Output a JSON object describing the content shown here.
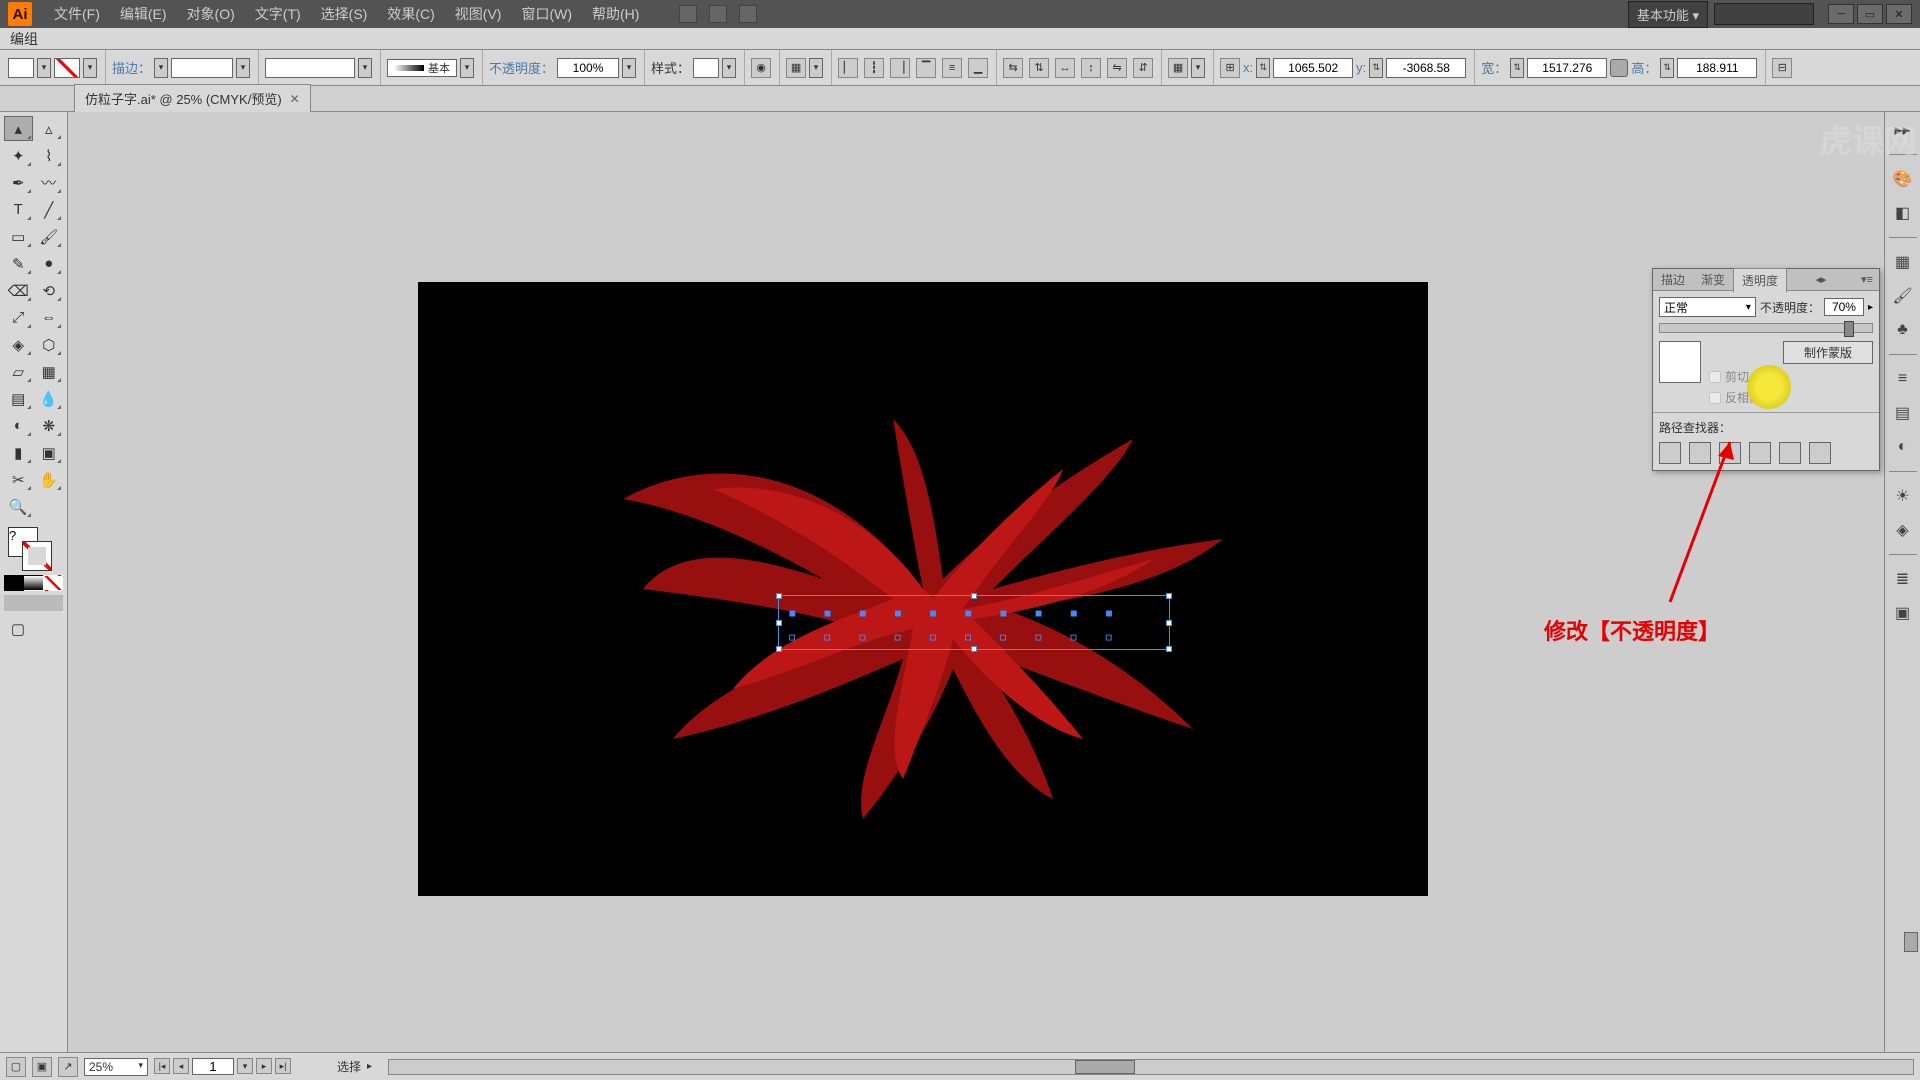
{
  "menubar": {
    "items": [
      "文件(F)",
      "编辑(E)",
      "对象(O)",
      "文字(T)",
      "选择(S)",
      "效果(C)",
      "视图(V)",
      "窗口(W)",
      "帮助(H)"
    ],
    "workspace": "基本功能"
  },
  "context": {
    "label": "编组"
  },
  "options": {
    "stroke_label": "描边：",
    "stroke_style": "基本",
    "opacity_label": "不透明度：",
    "opacity_value": "100%",
    "style_label": "样式：",
    "x_label": "x:",
    "x_value": "1065.502",
    "y_label": "y:",
    "y_value": "-3068.58",
    "w_label": "宽：",
    "w_value": "1517.276",
    "h_label": "高：",
    "h_value": "188.911"
  },
  "document": {
    "tab_title": "仿粒子字.ai* @ 25% (CMYK/预览)"
  },
  "panel": {
    "tabs": [
      "描边",
      "渐变",
      "透明度"
    ],
    "blend_mode": "正常",
    "opacity_label": "不透明度：",
    "opacity_value": "70%",
    "make_mask": "制作蒙版",
    "clip_label": "剪切",
    "invert_label": "反相蒙版",
    "pathfinder_label": "路径查找器："
  },
  "annotation": {
    "text": "修改【不透明度】"
  },
  "status": {
    "zoom": "25%",
    "page": "1",
    "hint": "选择"
  },
  "watermark": "虎课网"
}
